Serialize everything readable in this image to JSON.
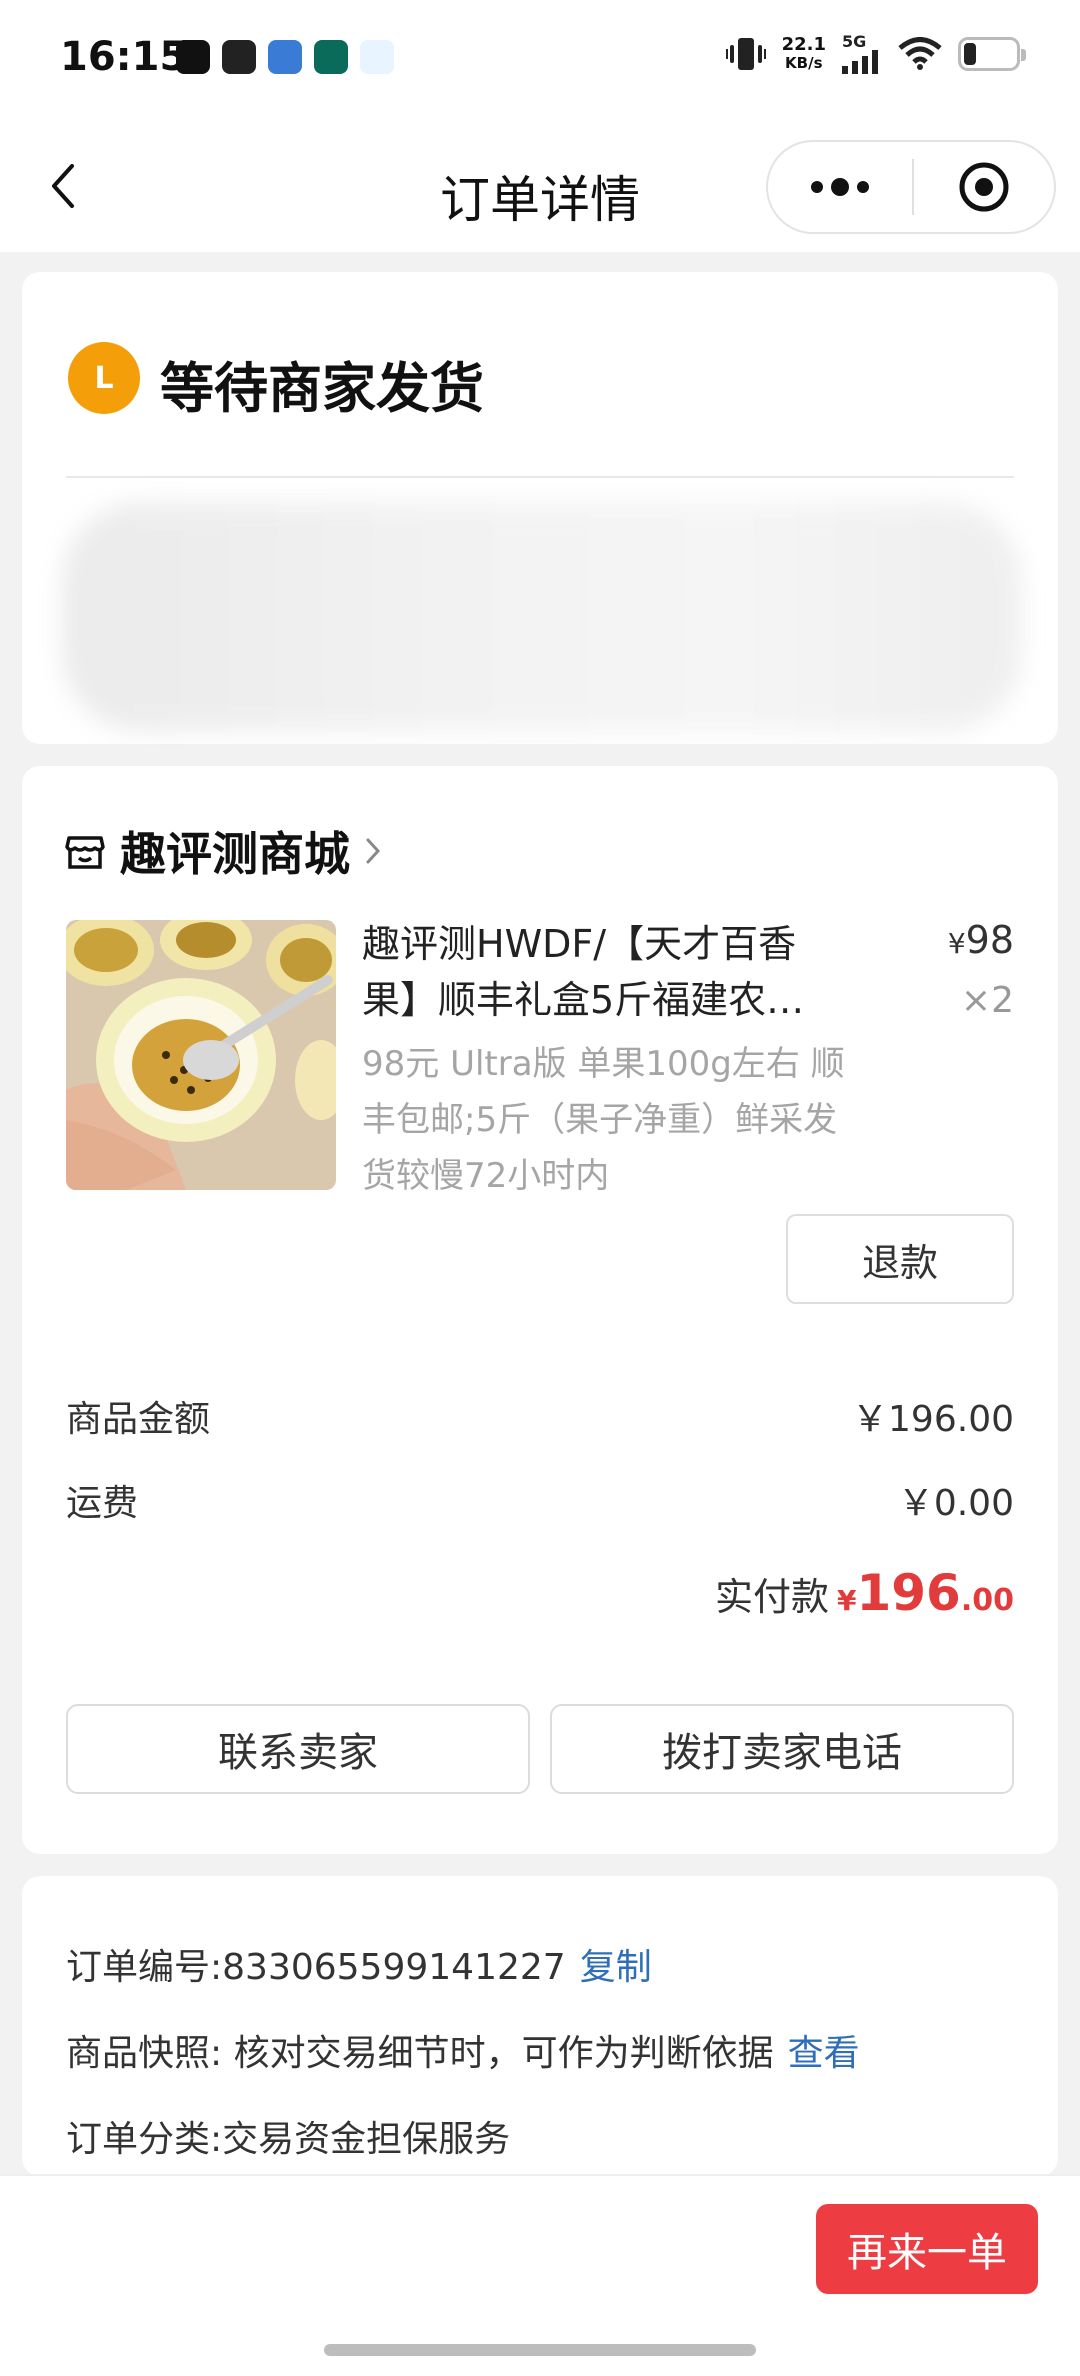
{
  "status_bar": {
    "time": "16:15",
    "net_speed_value": "22.1",
    "net_speed_unit": "KB/s",
    "network": "5G",
    "icons": [
      "vibrate-icon",
      "signal-icon",
      "wifi-icon",
      "battery-icon"
    ]
  },
  "nav": {
    "title": "订单详情"
  },
  "order_status": {
    "badge_letter": "L",
    "title": "等待商家发货",
    "badge_color": "#F49F0A"
  },
  "shop": {
    "name": "趣评测商城"
  },
  "product": {
    "title": "趣评测HWDF/【天才百香果】顺丰礼盒5斤福建农…",
    "spec": "98元 Ultra版 单果100g左右 顺丰包邮;5斤（果子净重）鲜采发货较慢72小时内",
    "price_symbol": "¥",
    "price": "98",
    "quantity": "×2",
    "refund_label": "退款"
  },
  "summary": {
    "goods_amount_label": "商品金额",
    "goods_amount_value": "￥196.00",
    "shipping_label": "运费",
    "shipping_value": "￥0.00",
    "paid_label": "实付款",
    "paid_symbol": "¥",
    "paid_int": "196",
    "paid_dec": ".00",
    "accent_color": "#E23B3B"
  },
  "actions": {
    "contact_seller": "联系卖家",
    "call_seller": "拨打卖家电话"
  },
  "order_info": {
    "order_no_label": "订单编号:833065599141227",
    "copy_label": "复制",
    "snapshot_label": "商品快照: 核对交易细节时，可作为判断依据",
    "view_label": "查看",
    "category_label": "订单分类:交易资金担保服务"
  },
  "bottom": {
    "reorder_label": "再来一单",
    "reorder_color": "#EE3C43"
  }
}
